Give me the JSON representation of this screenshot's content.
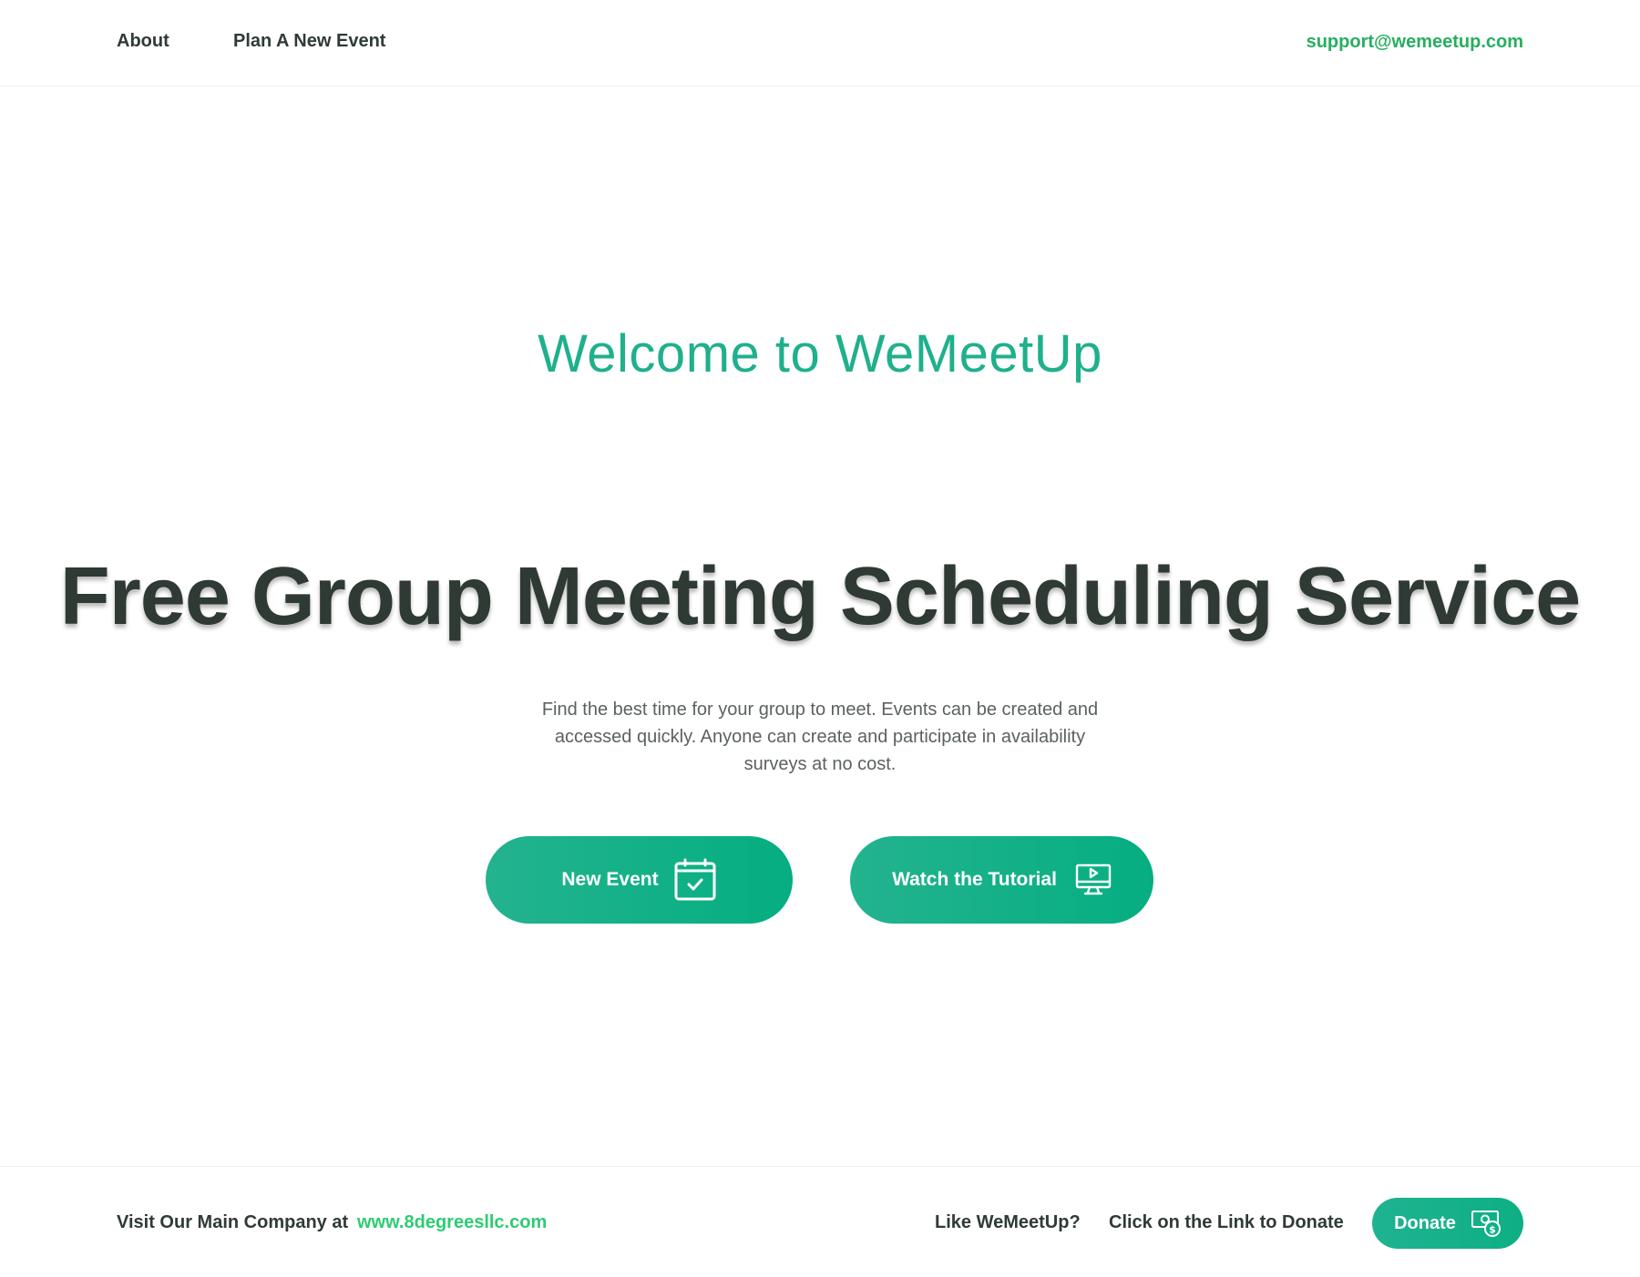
{
  "header": {
    "nav_about": "About",
    "nav_plan": "Plan A New Event",
    "support_email": "support@wemeetup.com"
  },
  "hero": {
    "welcome": "Welcome to WeMeetUp",
    "headline": "Free Group Meeting Scheduling Service",
    "description": "Find the best time for your group to meet. Events can be created and accessed quickly. Anyone can create and participate in availability surveys at no cost."
  },
  "buttons": {
    "new_event": "New Event",
    "new_event_icon": "calendar-check-icon",
    "tutorial": "Watch the Tutorial",
    "tutorial_icon": "monitor-play-icon"
  },
  "footer": {
    "visit_text": "Visit Our Main Company at",
    "company_link": "www.8degreesllc.com",
    "like_text": "Like WeMeetUp?",
    "click_text": "Click on the Link to Donate",
    "donate_label": "Donate",
    "donate_icon": "money-dollar-icon"
  },
  "colors": {
    "accent": "#1fb08c",
    "button_gradient_start": "#23b38f",
    "button_gradient_end": "#05ae81",
    "link_green": "#27ae60",
    "text_dark": "#2f3b34"
  }
}
